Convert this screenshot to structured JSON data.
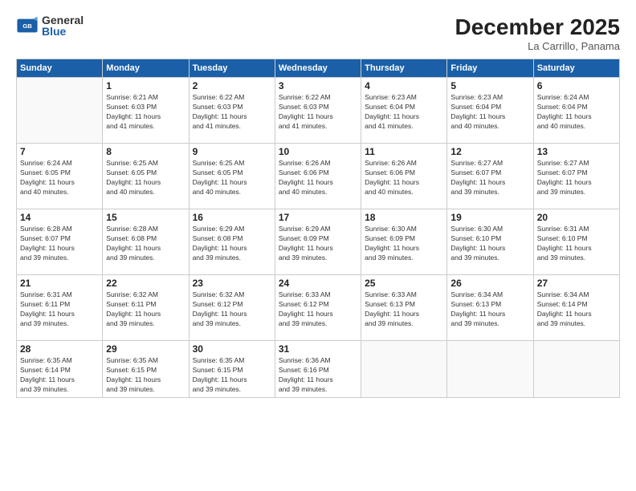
{
  "logo": {
    "general": "General",
    "blue": "Blue"
  },
  "header": {
    "month_year": "December 2025",
    "location": "La Carrillo, Panama"
  },
  "weekdays": [
    "Sunday",
    "Monday",
    "Tuesday",
    "Wednesday",
    "Thursday",
    "Friday",
    "Saturday"
  ],
  "weeks": [
    [
      {
        "day": "",
        "info": ""
      },
      {
        "day": "1",
        "info": "Sunrise: 6:21 AM\nSunset: 6:03 PM\nDaylight: 11 hours\nand 41 minutes."
      },
      {
        "day": "2",
        "info": "Sunrise: 6:22 AM\nSunset: 6:03 PM\nDaylight: 11 hours\nand 41 minutes."
      },
      {
        "day": "3",
        "info": "Sunrise: 6:22 AM\nSunset: 6:03 PM\nDaylight: 11 hours\nand 41 minutes."
      },
      {
        "day": "4",
        "info": "Sunrise: 6:23 AM\nSunset: 6:04 PM\nDaylight: 11 hours\nand 41 minutes."
      },
      {
        "day": "5",
        "info": "Sunrise: 6:23 AM\nSunset: 6:04 PM\nDaylight: 11 hours\nand 40 minutes."
      },
      {
        "day": "6",
        "info": "Sunrise: 6:24 AM\nSunset: 6:04 PM\nDaylight: 11 hours\nand 40 minutes."
      }
    ],
    [
      {
        "day": "7",
        "info": "Sunrise: 6:24 AM\nSunset: 6:05 PM\nDaylight: 11 hours\nand 40 minutes."
      },
      {
        "day": "8",
        "info": "Sunrise: 6:25 AM\nSunset: 6:05 PM\nDaylight: 11 hours\nand 40 minutes."
      },
      {
        "day": "9",
        "info": "Sunrise: 6:25 AM\nSunset: 6:05 PM\nDaylight: 11 hours\nand 40 minutes."
      },
      {
        "day": "10",
        "info": "Sunrise: 6:26 AM\nSunset: 6:06 PM\nDaylight: 11 hours\nand 40 minutes."
      },
      {
        "day": "11",
        "info": "Sunrise: 6:26 AM\nSunset: 6:06 PM\nDaylight: 11 hours\nand 40 minutes."
      },
      {
        "day": "12",
        "info": "Sunrise: 6:27 AM\nSunset: 6:07 PM\nDaylight: 11 hours\nand 39 minutes."
      },
      {
        "day": "13",
        "info": "Sunrise: 6:27 AM\nSunset: 6:07 PM\nDaylight: 11 hours\nand 39 minutes."
      }
    ],
    [
      {
        "day": "14",
        "info": "Sunrise: 6:28 AM\nSunset: 6:07 PM\nDaylight: 11 hours\nand 39 minutes."
      },
      {
        "day": "15",
        "info": "Sunrise: 6:28 AM\nSunset: 6:08 PM\nDaylight: 11 hours\nand 39 minutes."
      },
      {
        "day": "16",
        "info": "Sunrise: 6:29 AM\nSunset: 6:08 PM\nDaylight: 11 hours\nand 39 minutes."
      },
      {
        "day": "17",
        "info": "Sunrise: 6:29 AM\nSunset: 6:09 PM\nDaylight: 11 hours\nand 39 minutes."
      },
      {
        "day": "18",
        "info": "Sunrise: 6:30 AM\nSunset: 6:09 PM\nDaylight: 11 hours\nand 39 minutes."
      },
      {
        "day": "19",
        "info": "Sunrise: 6:30 AM\nSunset: 6:10 PM\nDaylight: 11 hours\nand 39 minutes."
      },
      {
        "day": "20",
        "info": "Sunrise: 6:31 AM\nSunset: 6:10 PM\nDaylight: 11 hours\nand 39 minutes."
      }
    ],
    [
      {
        "day": "21",
        "info": "Sunrise: 6:31 AM\nSunset: 6:11 PM\nDaylight: 11 hours\nand 39 minutes."
      },
      {
        "day": "22",
        "info": "Sunrise: 6:32 AM\nSunset: 6:11 PM\nDaylight: 11 hours\nand 39 minutes."
      },
      {
        "day": "23",
        "info": "Sunrise: 6:32 AM\nSunset: 6:12 PM\nDaylight: 11 hours\nand 39 minutes."
      },
      {
        "day": "24",
        "info": "Sunrise: 6:33 AM\nSunset: 6:12 PM\nDaylight: 11 hours\nand 39 minutes."
      },
      {
        "day": "25",
        "info": "Sunrise: 6:33 AM\nSunset: 6:13 PM\nDaylight: 11 hours\nand 39 minutes."
      },
      {
        "day": "26",
        "info": "Sunrise: 6:34 AM\nSunset: 6:13 PM\nDaylight: 11 hours\nand 39 minutes."
      },
      {
        "day": "27",
        "info": "Sunrise: 6:34 AM\nSunset: 6:14 PM\nDaylight: 11 hours\nand 39 minutes."
      }
    ],
    [
      {
        "day": "28",
        "info": "Sunrise: 6:35 AM\nSunset: 6:14 PM\nDaylight: 11 hours\nand 39 minutes."
      },
      {
        "day": "29",
        "info": "Sunrise: 6:35 AM\nSunset: 6:15 PM\nDaylight: 11 hours\nand 39 minutes."
      },
      {
        "day": "30",
        "info": "Sunrise: 6:35 AM\nSunset: 6:15 PM\nDaylight: 11 hours\nand 39 minutes."
      },
      {
        "day": "31",
        "info": "Sunrise: 6:36 AM\nSunset: 6:16 PM\nDaylight: 11 hours\nand 39 minutes."
      },
      {
        "day": "",
        "info": ""
      },
      {
        "day": "",
        "info": ""
      },
      {
        "day": "",
        "info": ""
      }
    ]
  ]
}
